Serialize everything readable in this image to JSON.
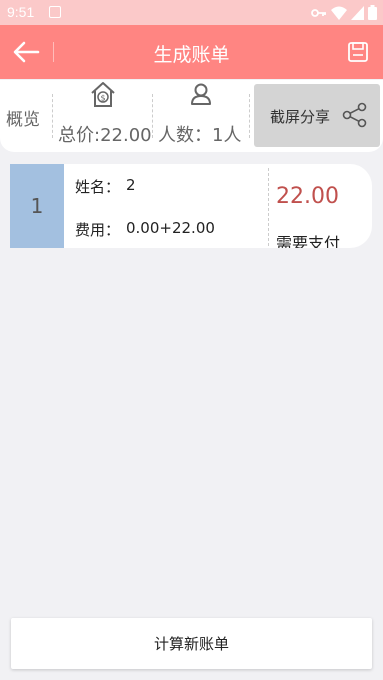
{
  "status_bar": {
    "time": "9:51",
    "icons": [
      "notification-icon",
      "vpn-key-icon",
      "wifi-icon",
      "signal-icon",
      "battery-icon"
    ]
  },
  "app_bar": {
    "title": "生成账单",
    "back_icon": "arrow-left-icon",
    "save_icon": "save-icon"
  },
  "overview": {
    "label": "概览",
    "total_price": "总价:22.00",
    "people_count": "人数：1人",
    "share_label": "截屏分享",
    "total_icon": "house-dollar-icon",
    "people_icon": "person-icon",
    "share_icon": "share-icon"
  },
  "bill_items": [
    {
      "index": "1",
      "name_label": "姓名：",
      "name": "2",
      "fee_label": "费用：",
      "fee": "0.00+22.00",
      "amount": "22.00",
      "pay_label": "需要支付"
    }
  ],
  "footer": {
    "calc_button": "计算新账单"
  },
  "colors": {
    "status_bar": "#fbc9c9",
    "app_bar": "#ff8582",
    "index_bg": "#a3c0e0",
    "amount": "#c0504d",
    "background": "#f1f1f4"
  }
}
